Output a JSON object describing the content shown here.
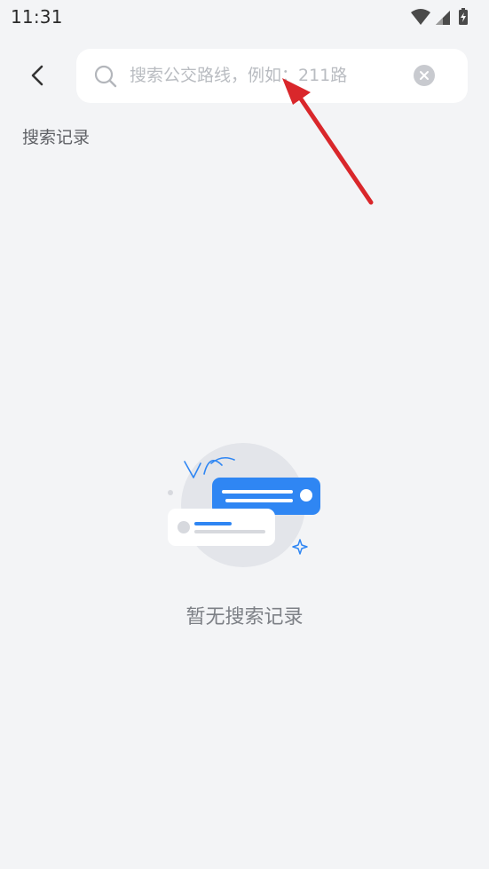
{
  "status_bar": {
    "time": "11:31",
    "icons": [
      "wifi-icon",
      "signal-icon",
      "battery-charging-icon"
    ]
  },
  "header": {
    "back_icon": "chevron-left-icon",
    "search": {
      "placeholder": "搜索公交路线，例如：211路",
      "value": "",
      "search_icon": "search-icon",
      "clear_icon": "clear-circle-icon"
    }
  },
  "history": {
    "title": "搜索记录",
    "items": [],
    "empty_text": "暂无搜索记录"
  },
  "colors": {
    "background": "#f3f4f6",
    "accent": "#2f86f3",
    "annotation_arrow": "#d9272b"
  }
}
